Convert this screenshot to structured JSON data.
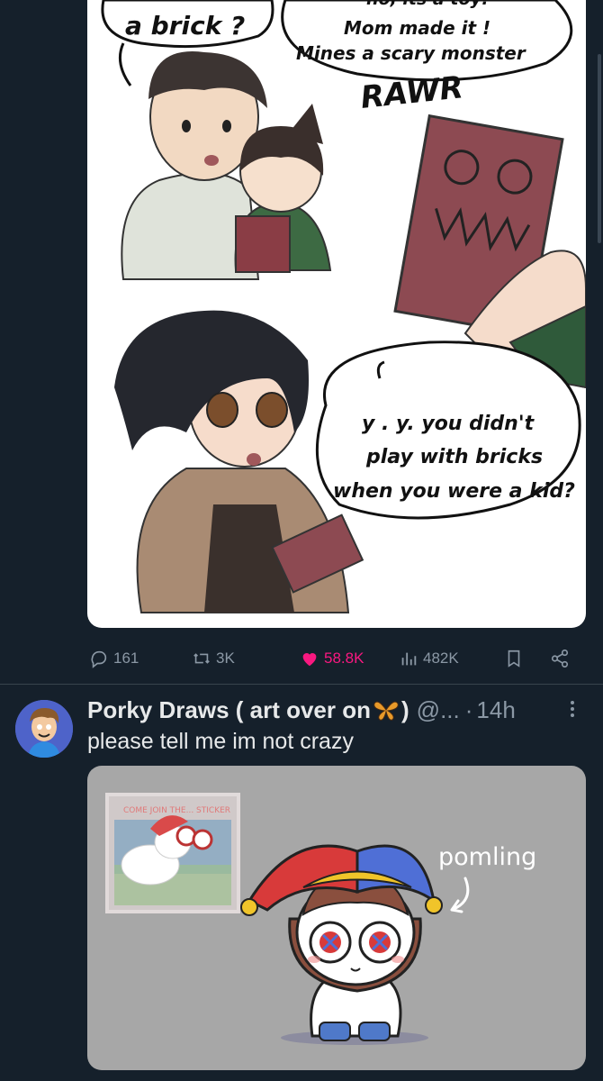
{
  "post1": {
    "comic": {
      "bubble_top_left": "a brick ?",
      "bubble_top_right_partial": "no, its a toy!",
      "bubble_top_right_line1": "Mom made it !",
      "bubble_top_right_line2": "Mines a scary monster",
      "sound_effect": "RAWR",
      "bubble_bottom_line1": "y . y. you didn't",
      "bubble_bottom_line2": "play with bricks",
      "bubble_bottom_line3": "when you were a kid?"
    },
    "actions": {
      "replies": "161",
      "reposts": "3K",
      "likes": "58.8K",
      "views": "482K"
    },
    "colors": {
      "like": "#f91880",
      "muted": "#8b98a5"
    }
  },
  "post2": {
    "author_name": "Porky Draws ( art over on ",
    "author_name_suffix": ")",
    "handle": "@...",
    "separator": "·",
    "time": "14h",
    "text": "please tell me im not crazy",
    "image": {
      "label": "pomling",
      "sticker_text": "COME JOIN THE... STICKER"
    }
  },
  "icons": [
    "reply-icon",
    "repost-icon",
    "like-icon",
    "views-icon",
    "bookmark-icon",
    "share-icon",
    "more-icon",
    "butterfly-icon"
  ]
}
